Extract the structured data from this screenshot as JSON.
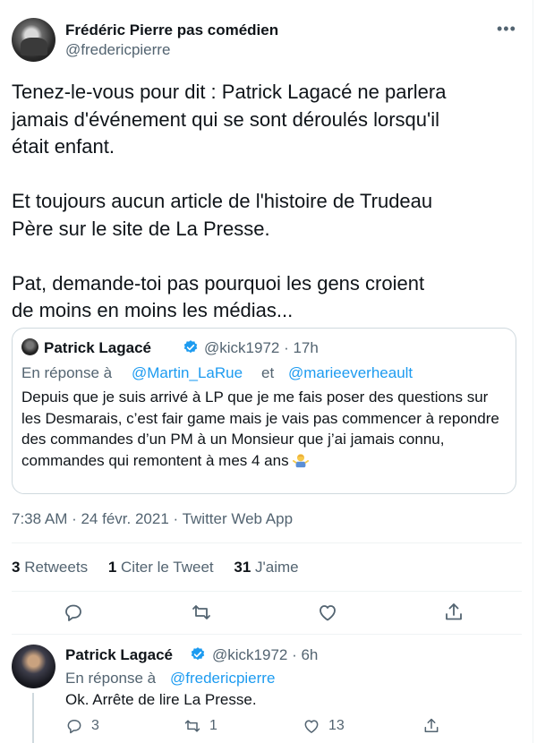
{
  "tweet": {
    "author_name": "Frédéric Pierre pas comédien",
    "author_handle": "@fredericpierre",
    "text": "Tenez-le-vous pour dit : Patrick Lagacé ne parlera\njamais d'événement qui se sont déroulés lorsqu'il\nétait enfant.\n\nEt toujours aucun article de l'histoire de Trudeau\nPère sur le site de La Presse.\n\nPat, demande-toi pas pourquoi les gens croient\nde moins en moins les médias...",
    "timestamp": "7:38 AM · 24 févr. 2021 · Twitter Web App",
    "stats": {
      "retweets_count": "3",
      "retweets_label": "Retweets",
      "quotes_count": "1",
      "quotes_label": "Citer le Tweet",
      "likes_count": "31",
      "likes_label": "J'aime"
    }
  },
  "quoted_tweet": {
    "author_name": "Patrick Lagacé",
    "handle_time": "@kick1972 · 17h",
    "reply_prefix": "En réponse à",
    "mention_1": "@Martin_LaRue",
    "and_word": "et",
    "mention_2": "@marieeverheault",
    "text": "Depuis que je suis arrivé à LP que je me fais poser des questions sur les Desmarais, c’est fair game mais je vais pas commencer à repondre des commandes d’un PM à un Monsieur que j’ai jamais connu, commandes qui remontent à mes 4 ans"
  },
  "reply_tweet": {
    "author_name": "Patrick Lagacé",
    "handle_time": "@kick1972 · 6h",
    "reply_prefix": "En réponse à",
    "mention": "@fredericpierre",
    "text": "Ok. Arrête de lire La Presse.",
    "reply_count": "3",
    "retweet_count": "1",
    "like_count": "13"
  },
  "colors": {
    "accent": "#1d9bf0",
    "secondary_text": "#536471",
    "primary_text": "#0f1419",
    "border": "#cfd9de"
  },
  "icons": {
    "more": "more-icon",
    "verified": "verified-icon",
    "reply": "reply-icon",
    "retweet": "retweet-icon",
    "like": "heart-icon",
    "share": "share-icon",
    "emoji": "person-shrugging-emoji"
  }
}
